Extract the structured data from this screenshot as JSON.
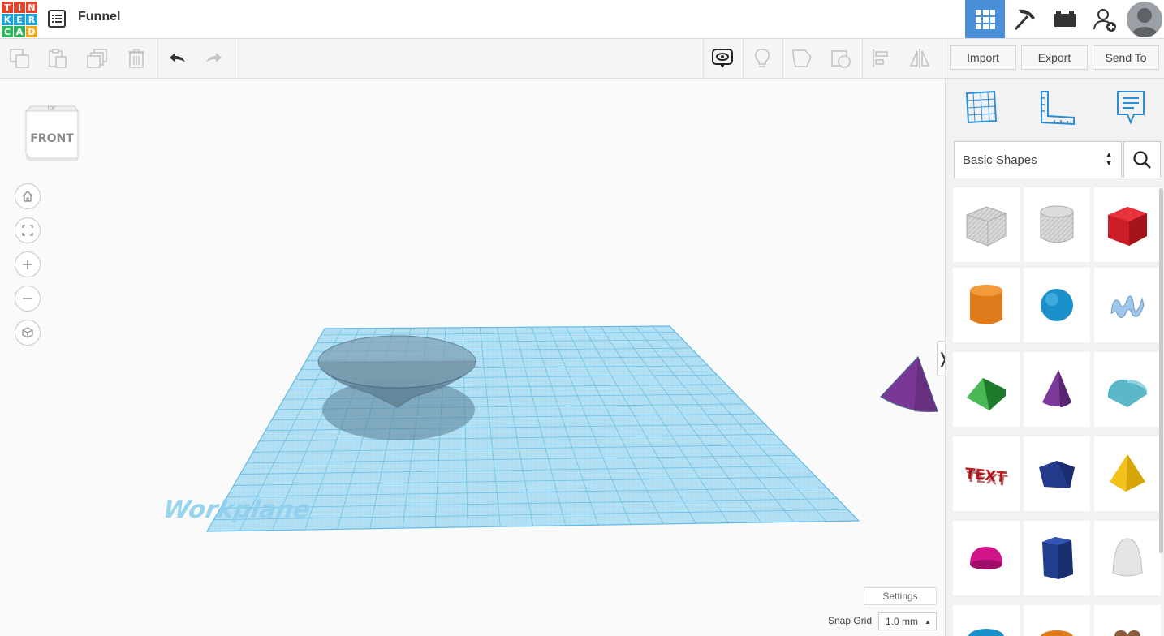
{
  "header": {
    "logo_letters": [
      "T",
      "I",
      "N",
      "K",
      "E",
      "R",
      "C",
      "A",
      "D"
    ],
    "logo_colors": [
      "#e2432b",
      "#e2432b",
      "#e2432b",
      "#19a3de",
      "#19a3de",
      "#19a3de",
      "#2fb55d",
      "#2fb55d",
      "#f5a523"
    ],
    "doc_title": "Funnel",
    "icons": [
      "design-grid-icon",
      "pickaxe-icon",
      "brick-icon",
      "add-user-icon",
      "avatar"
    ]
  },
  "toolbar": {
    "left_icons": [
      "copy-icon",
      "paste-icon",
      "duplicate-icon",
      "delete-icon",
      "undo-icon",
      "redo-icon"
    ],
    "right_icons": [
      "notes-icon",
      "light-bulb-icon",
      "shape-group-icon",
      "hole-icon",
      "align-icon",
      "mirror-icon"
    ],
    "import_label": "Import",
    "export_label": "Export",
    "send_to_label": "Send To"
  },
  "viewport": {
    "view_cube_front": "FRONT",
    "view_cube_top": "TOP",
    "nav": [
      "home-icon",
      "fit-view-icon",
      "zoom-in-icon",
      "zoom-out-icon",
      "perspective-icon"
    ],
    "workplane_label": "Workplane",
    "settings_label": "Settings",
    "snap_grid_label": "Snap Grid",
    "snap_grid_value": "1.0 mm",
    "collapse_glyph": "❭"
  },
  "panel": {
    "top_icons": [
      "workplane-icon",
      "ruler-icon",
      "notes-panel-icon"
    ],
    "category": "Basic Shapes",
    "shapes": [
      "box-hole",
      "cylinder-hole",
      "box",
      "cylinder",
      "sphere",
      "scribble",
      "roof",
      "cone",
      "round-roof",
      "text",
      "polygon",
      "pyramid",
      "half-sphere",
      "hexagonal-prism",
      "paraboloid",
      "torus",
      "tube",
      "heart"
    ]
  },
  "colors": {
    "accent": "#4a90d9",
    "workplane": "#a9d8f0",
    "grid_line": "#6cbfe6"
  }
}
